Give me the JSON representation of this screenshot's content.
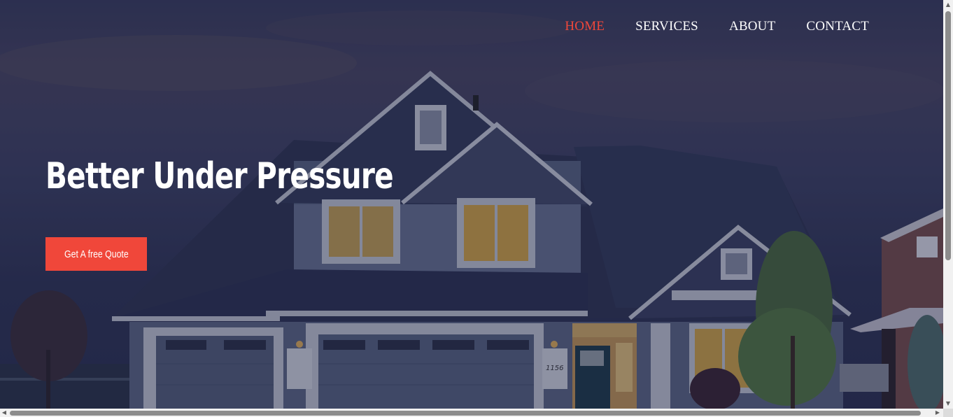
{
  "nav": {
    "items": [
      {
        "label": "HOME",
        "active": true
      },
      {
        "label": "SERVICES",
        "active": false
      },
      {
        "label": "ABOUT",
        "active": false
      },
      {
        "label": "CONTACT",
        "active": false
      }
    ]
  },
  "hero": {
    "headline": "Better Under Pressure",
    "cta_label": "Get A free Quote",
    "house_number": "1156"
  },
  "colors": {
    "accent": "#f0473a",
    "overlay": "#161a3c",
    "text": "#ffffff"
  },
  "icons": {
    "scroll_up": "triangle-up-icon",
    "scroll_down": "triangle-down-icon",
    "scroll_left": "triangle-left-icon",
    "scroll_right": "triangle-right-icon"
  }
}
